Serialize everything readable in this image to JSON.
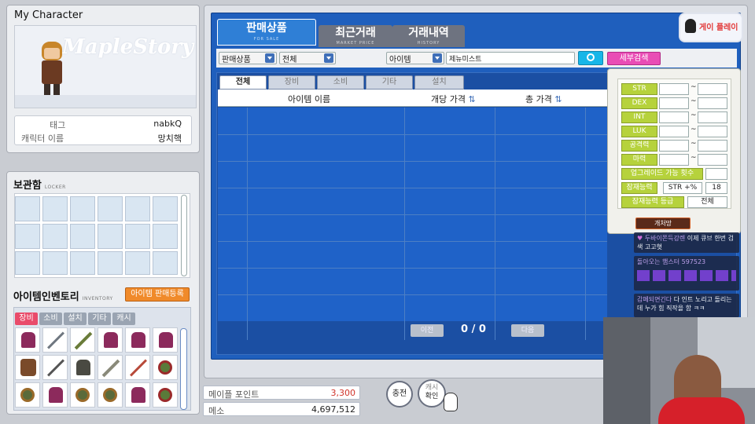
{
  "character": {
    "title": "My Character",
    "tag_label": "태그",
    "tag_value": "nabkQ",
    "name_label": "캐릭터 이름",
    "name_value": "망치핵",
    "logo_text": "MapleStory"
  },
  "locker": {
    "title": "보관함",
    "subtitle": "LOCKER"
  },
  "inventory": {
    "title": "아이템인벤토리",
    "subtitle": "INVENTORY",
    "register_button": "아이템 판매등록",
    "tabs": [
      "장비",
      "소비",
      "설치",
      "기타",
      "캐시"
    ]
  },
  "points": {
    "maple_point_label": "메이플 포인트",
    "maple_point_value": "3,300",
    "meso_label": "메소",
    "meso_value": "4,697,512"
  },
  "buttons": {
    "charge": "충전",
    "cash_check_line1": "캐시",
    "cash_check_line2": "확인"
  },
  "market": {
    "tabs": [
      {
        "label": "판매상품",
        "sub": "FOR SALE"
      },
      {
        "label": "최근거래",
        "sub": "MARKET PRICE"
      },
      {
        "label": "거래내역",
        "sub": "HISTORY"
      }
    ],
    "filter1": "판매상품",
    "filter2": "전체",
    "filter3": "아이템",
    "search_value": "제뉴미스트",
    "detail_search": "세부검색",
    "subtabs": [
      "전체",
      "장비",
      "소비",
      "기타",
      "설치"
    ],
    "columns": [
      "아이템 이름",
      "개당 가격",
      "총 가격"
    ],
    "pagination": {
      "prev": "이전",
      "next": "다음",
      "page": "0 / 0"
    }
  },
  "detail": {
    "stats": [
      "STR",
      "DEX",
      "INT",
      "LUK",
      "공격력",
      "마력"
    ],
    "upgrade_label": "업그레이드 가능 횟수",
    "potential_label": "잠재능력",
    "potential_value": "STR +%",
    "potential_num": "18",
    "potential_grade_label": "잠재능력 등급",
    "potential_grade_value": "전체",
    "collapse": "개처망"
  },
  "chat": [
    {
      "name": "두바이쫀득강렌",
      "text": "이제 큐브 한번 검색 고고혓"
    },
    {
      "name": "돌아오는 햄스터",
      "text": "597523"
    },
    {
      "name": "감페되면긴다",
      "text": "다 인트 노리고 돌리는데 누가 힘 직작을 함 ㅋㅋ"
    }
  ],
  "overlay_logo": "게이 플레이",
  "colors": {
    "board_blue": "#1f5fbd",
    "tab_active": "#2f7fd6",
    "lime": "#b6d23c",
    "register": "#f08a2a",
    "detail_btn": "#e94db5"
  }
}
